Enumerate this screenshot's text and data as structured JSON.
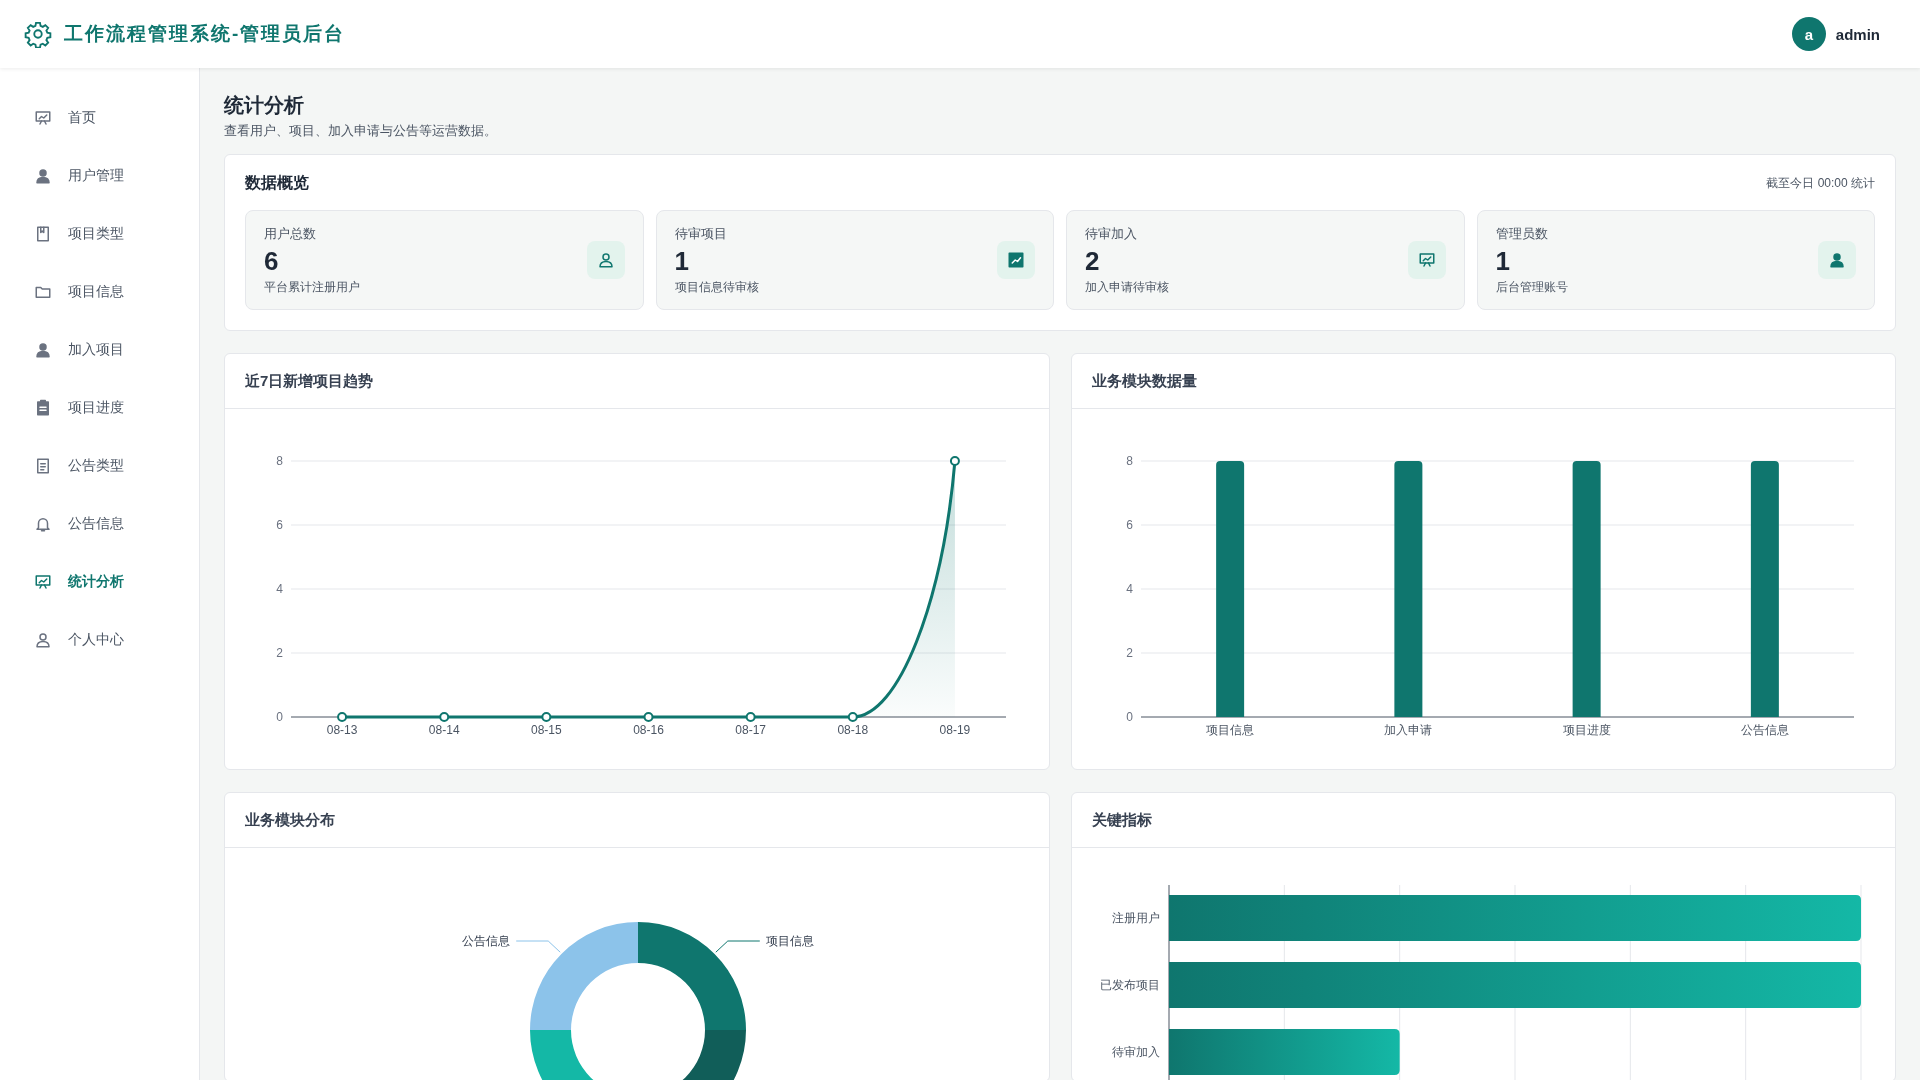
{
  "header": {
    "title": "工作流程管理系统-管理员后台",
    "user": {
      "avatar": "a",
      "name": "admin"
    }
  },
  "sidebar": {
    "items": [
      {
        "label": "首页",
        "selected": false
      },
      {
        "label": "用户管理",
        "selected": false
      },
      {
        "label": "项目类型",
        "selected": false
      },
      {
        "label": "项目信息",
        "selected": false
      },
      {
        "label": "加入项目",
        "selected": false
      },
      {
        "label": "项目进度",
        "selected": false
      },
      {
        "label": "公告类型",
        "selected": false
      },
      {
        "label": "公告信息",
        "selected": false
      },
      {
        "label": "统计分析",
        "selected": true
      },
      {
        "label": "个人中心",
        "selected": false
      }
    ]
  },
  "page": {
    "title": "统计分析",
    "subtitle": "查看用户、项目、加入申请与公告等运营数据。"
  },
  "overview": {
    "title": "数据概览",
    "note": "截至今日 00:00 统计",
    "stats": [
      {
        "label": "用户总数",
        "value": "6",
        "description": "平台累计注册用户"
      },
      {
        "label": "待审项目",
        "value": "1",
        "description": "项目信息待审核"
      },
      {
        "label": "待审加入",
        "value": "2",
        "description": "加入申请待审核"
      },
      {
        "label": "管理员数",
        "value": "1",
        "description": "后台管理账号"
      }
    ]
  },
  "trend_chart": {
    "title": "近7日新增项目趋势",
    "chart_data": {
      "type": "line",
      "grid": true,
      "categories": [
        "08-13",
        "08-14",
        "08-15",
        "08-16",
        "08-17",
        "08-18",
        "08-19"
      ],
      "series": [
        {
          "color": "#0f766e",
          "marker": true,
          "values": [
            0,
            0,
            0,
            0,
            0,
            0,
            8
          ]
        }
      ],
      "ylim": [
        0,
        8
      ],
      "yticks": [
        0,
        2,
        4,
        6,
        8
      ]
    }
  },
  "module_chart": {
    "title": "业务模块数据量",
    "chart_data": {
      "type": "bar",
      "grid": true,
      "categories": [
        "项目信息",
        "加入申请",
        "项目进度",
        "公告信息"
      ],
      "series": [
        {
          "color": "#0f766e",
          "values": [
            8,
            8,
            8,
            8
          ]
        }
      ],
      "ylim": [
        0,
        8
      ],
      "yticks": [
        0,
        2,
        4,
        6,
        8
      ]
    }
  },
  "distribution_chart": {
    "title": "业务模块分布",
    "chart_data": {
      "type": "donut",
      "categories": [
        "项目信息",
        null,
        null,
        "公告信息"
      ],
      "colors": [
        "#0f766e",
        "#115e59",
        "#14b8a6",
        "#8cc3ea"
      ],
      "values": [
        25,
        25,
        25,
        25
      ]
    }
  },
  "metrics_chart": {
    "title": "关键指标",
    "bar_labels": [
      "注册用户",
      "已发布项目",
      "待审加入"
    ]
  }
}
